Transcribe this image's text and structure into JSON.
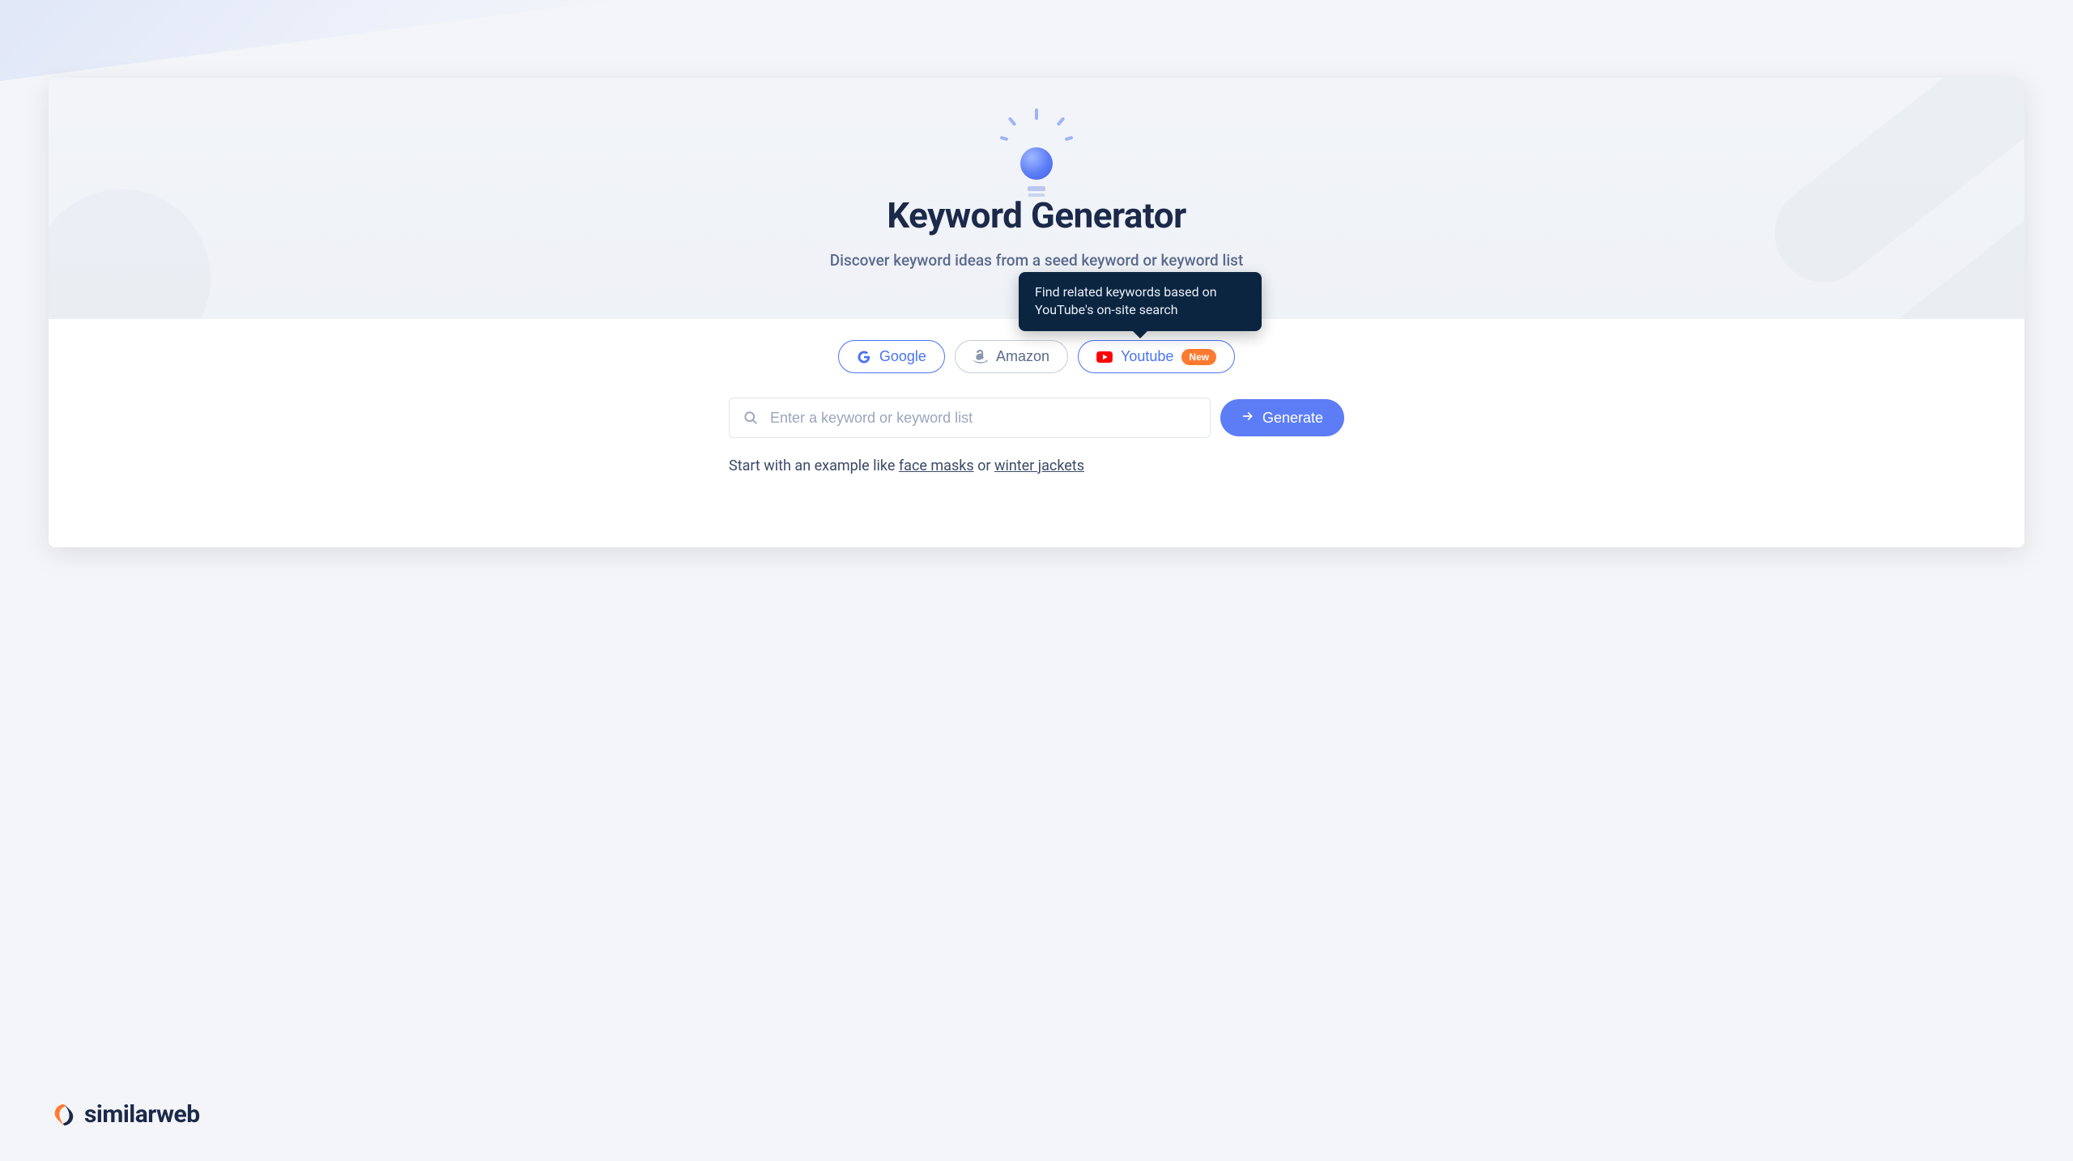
{
  "hero": {
    "title": "Keyword Generator",
    "subtitle": "Discover keyword ideas from a seed keyword or keyword list"
  },
  "tooltip": {
    "text": "Find related keywords based on YouTube's on-site search"
  },
  "sources": {
    "google": "Google",
    "amazon": "Amazon",
    "youtube": "Youtube",
    "youtube_badge": "New"
  },
  "search": {
    "placeholder": "Enter a keyword or keyword list",
    "button": "Generate"
  },
  "examples": {
    "prefix": "Start with an example like ",
    "link1": "face masks",
    "middle": " or ",
    "link2": "winter jackets"
  },
  "brand": {
    "name": "similarweb"
  }
}
